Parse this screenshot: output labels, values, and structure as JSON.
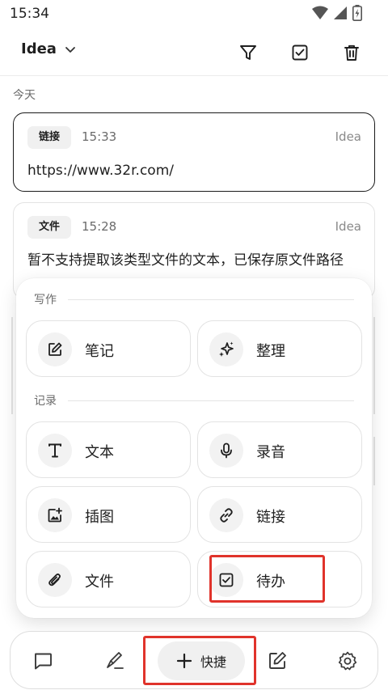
{
  "status_bar": {
    "time": "15:34",
    "icons": [
      "wifi-icon",
      "signal-icon",
      "battery-icon"
    ]
  },
  "toolbar": {
    "filter_label": "Idea",
    "icons": [
      "chevron-down-icon",
      "filter-icon",
      "checkbox-icon",
      "trash-icon"
    ]
  },
  "day_label": "今天",
  "cards": [
    {
      "tag": "链接",
      "time": "15:33",
      "source": "Idea",
      "body": "https://www.32r.com/"
    },
    {
      "tag": "文件",
      "time": "15:28",
      "source": "Idea",
      "body": "暂不支持提取该类型文件的文本，已保存原文件路径"
    }
  ],
  "quick_panel": {
    "sections": [
      {
        "title": "写作",
        "items": [
          {
            "label": "笔记",
            "icon": "edit-note-icon"
          },
          {
            "label": "整理",
            "icon": "sparkle-icon"
          }
        ]
      },
      {
        "title": "记录",
        "items": [
          {
            "label": "文本",
            "icon": "text-icon"
          },
          {
            "label": "录音",
            "icon": "microphone-icon"
          },
          {
            "label": "插图",
            "icon": "add-image-icon"
          },
          {
            "label": "链接",
            "icon": "link-icon"
          },
          {
            "label": "文件",
            "icon": "paperclip-icon"
          },
          {
            "label": "待办",
            "icon": "checkbox-icon"
          }
        ]
      }
    ]
  },
  "bottom_bar": {
    "quick_label": "快捷",
    "icons": [
      "chat-icon",
      "brush-icon",
      "plus-icon",
      "compose-icon",
      "settings-icon"
    ]
  },
  "colors": {
    "highlight": "#e0332b",
    "text": "#1f1f1f",
    "muted": "#6b6b6b"
  }
}
